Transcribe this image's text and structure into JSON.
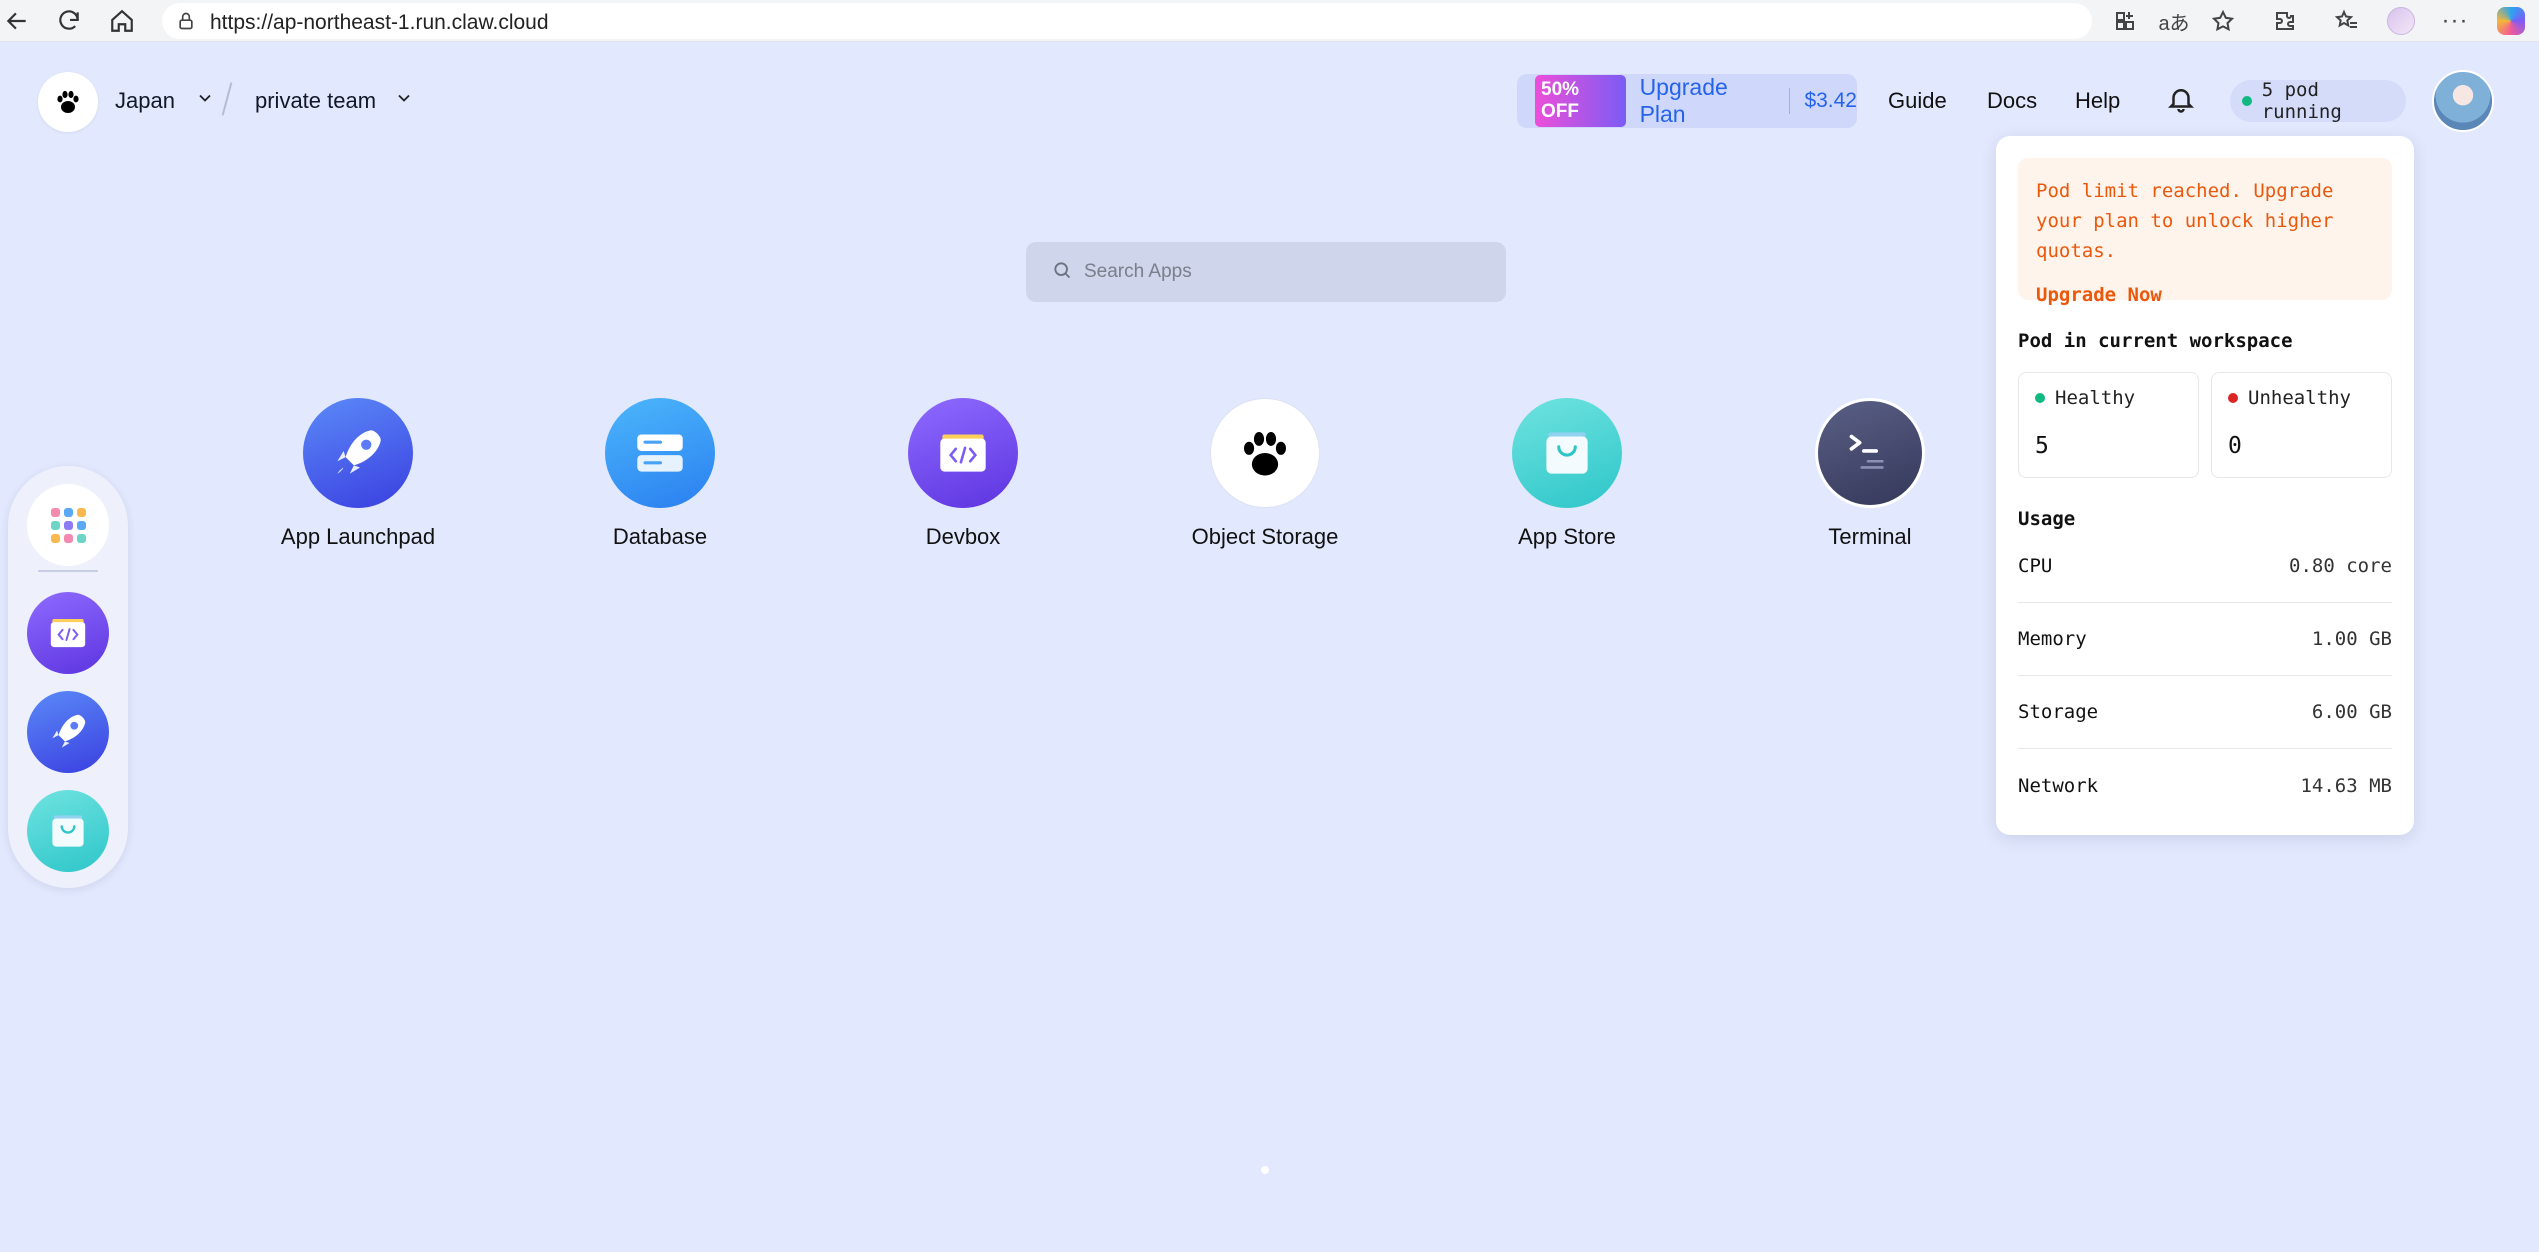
{
  "browser": {
    "url": "https://ap-northeast-1.run.claw.cloud"
  },
  "header": {
    "region": "Japan",
    "team": "private team",
    "promo_badge": "50% OFF",
    "upgrade_label": "Upgrade Plan",
    "upgrade_price": "$3.42",
    "links": [
      "Guide",
      "Docs",
      "Help"
    ],
    "pod_status": "5 pod running"
  },
  "search": {
    "placeholder": "Search Apps"
  },
  "apps": [
    {
      "label": "App Launchpad",
      "icon": "rocket-icon"
    },
    {
      "label": "Database",
      "icon": "database-icon"
    },
    {
      "label": "Devbox",
      "icon": "devbox-icon"
    },
    {
      "label": "Object Storage",
      "icon": "paw-icon"
    },
    {
      "label": "App Store",
      "icon": "shopping-bag-icon"
    },
    {
      "label": "Terminal",
      "icon": "terminal-icon"
    }
  ],
  "dock": {
    "items": [
      "apps-grid-icon",
      "devbox-icon",
      "rocket-icon",
      "shopping-bag-icon"
    ]
  },
  "pod_popover": {
    "warning_text": "Pod limit reached. Upgrade your plan to unlock higher quotas.",
    "warning_action": "Upgrade Now",
    "workspace_title": "Pod in current workspace",
    "healthy_label": "Healthy",
    "healthy_count": "5",
    "unhealthy_label": "Unhealthy",
    "unhealthy_count": "0",
    "usage_title": "Usage",
    "usage": [
      {
        "name": "CPU",
        "value": "0.80 core"
      },
      {
        "name": "Memory",
        "value": "1.00 GB"
      },
      {
        "name": "Storage",
        "value": "6.00 GB"
      },
      {
        "name": "Network",
        "value": "14.63 MB"
      }
    ]
  },
  "colors": {
    "page_bg": "#e2e8fd",
    "accent": "#2563eb",
    "warning": "#ea580c",
    "healthy": "#10b981",
    "unhealthy": "#dc2626"
  }
}
